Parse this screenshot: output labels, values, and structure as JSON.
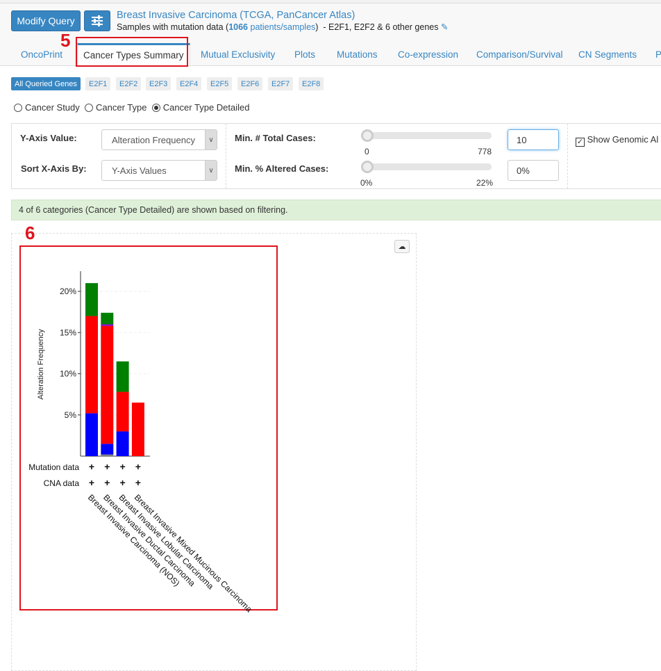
{
  "header": {
    "modify_query": "Modify Query",
    "settings_icon": "sliders-icon",
    "study_title": "Breast Invasive Carcinoma (TCGA, PanCancer Atlas)",
    "samples_prefix": "Samples with mutation data (",
    "samples_count": "1066",
    "samples_link": " patients/samples",
    "samples_suffix": ")",
    "genes_text": "- E2F1, E2F2 & 6 other genes",
    "edit_icon": "pencil-icon"
  },
  "tabs": [
    "OncoPrint",
    "Cancer Types Summary",
    "Mutual Exclusivity",
    "Plots",
    "Mutations",
    "Co-expression",
    "Comparison/Survival",
    "CN Segments",
    "P"
  ],
  "annotations": {
    "a5": "5",
    "a6": "6"
  },
  "genes": [
    "All Queried Genes",
    "E2F1",
    "E2F2",
    "E2F3",
    "E2F4",
    "E2F5",
    "E2F6",
    "E2F7",
    "E2F8"
  ],
  "grouping": {
    "options": [
      "Cancer Study",
      "Cancer Type",
      "Cancer Type Detailed"
    ],
    "selected": "Cancer Type Detailed"
  },
  "controls": {
    "y_axis_label": "Y-Axis Value:",
    "y_axis_value": "Alteration Frequency",
    "sort_label": "Sort X-Axis By:",
    "sort_value": "Y-Axis Values",
    "min_total_label": "Min. # Total Cases:",
    "min_total_min": "0",
    "min_total_max": "778",
    "min_total_value": "10",
    "min_altered_label": "Min. % Altered Cases:",
    "min_altered_min": "0%",
    "min_altered_max": "22%",
    "min_altered_value": "0%",
    "show_genomic": "Show Genomic Al"
  },
  "alert": "4 of 6 categories (Cancer Type Detailed) are shown based on filtering.",
  "download_icon": "cloud-download-icon",
  "chart_data": {
    "type": "bar",
    "stacked": true,
    "ylabel": "Alteration Frequency",
    "ylim": [
      0,
      22
    ],
    "yticks": [
      "5%",
      "10%",
      "15%",
      "20%"
    ],
    "categories": [
      "Breast Invasive Carcinoma (NOS)",
      "Breast Invasive Ductal Carcinoma",
      "Breast Invasive Lobular Carcinoma",
      "Breast Invasive Mixed Mucinous Carcinoma"
    ],
    "series": [
      {
        "color": "#808080",
        "values": [
          0,
          0.2,
          0,
          0
        ]
      },
      {
        "color": "#0000ff",
        "values": [
          5.2,
          1.3,
          3.0,
          0
        ]
      },
      {
        "color": "#ff0000",
        "values": [
          11.8,
          14.3,
          4.8,
          6.5
        ]
      },
      {
        "color": "#8b00c9",
        "values": [
          0,
          0.2,
          0,
          0
        ]
      },
      {
        "color": "#008000",
        "values": [
          4.0,
          1.4,
          3.7,
          0
        ]
      }
    ],
    "rows": [
      {
        "label": "Mutation data",
        "marks": [
          "+",
          "+",
          "+",
          "+"
        ]
      },
      {
        "label": "CNA data",
        "marks": [
          "+",
          "+",
          "+",
          "+"
        ]
      }
    ]
  }
}
